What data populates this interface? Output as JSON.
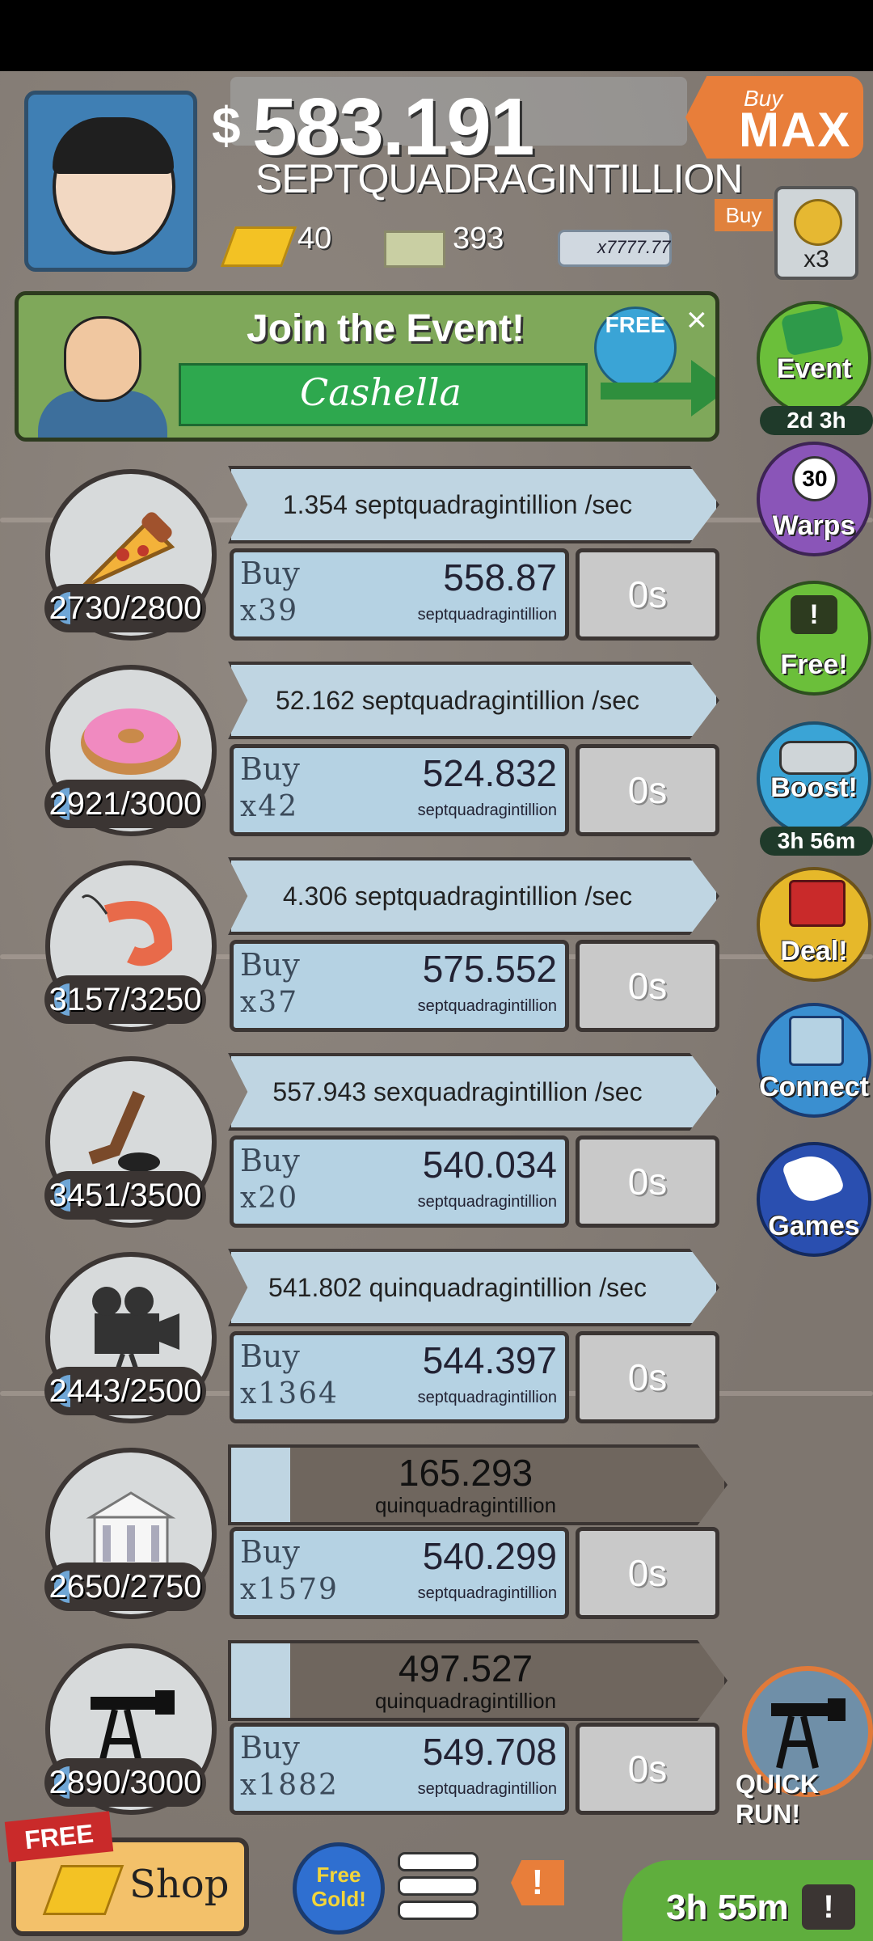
{
  "header": {
    "currency_symbol": "$",
    "money_value": "583.191",
    "money_unit": "SEPTQUADRAGINTILLION",
    "buy_max": {
      "top": "Buy",
      "bottom": "MAX"
    },
    "gold": "40",
    "megabucks": "393",
    "megaticket": "x7777.77",
    "buy_multiplier_tag": "Buy",
    "bag_multiplier": "x3"
  },
  "event_banner": {
    "title": "Join the Event!",
    "name": "Cashella",
    "free": "FREE",
    "close": "×"
  },
  "businesses": [
    {
      "name": "pizza",
      "count": "2730/2800",
      "fill": 0.975,
      "rate": "1.354 septquadragintillion /sec",
      "buy_label": "Buy",
      "buy_qty": "x39",
      "cost": "558.87",
      "cost_unit": "septquadragintillion",
      "timer": "0s"
    },
    {
      "name": "donut",
      "count": "2921/3000",
      "fill": 0.974,
      "rate": "52.162 septquadragintillion /sec",
      "buy_label": "Buy",
      "buy_qty": "x42",
      "cost": "524.832",
      "cost_unit": "septquadragintillion",
      "timer": "0s"
    },
    {
      "name": "shrimp",
      "count": "3157/3250",
      "fill": 0.971,
      "rate": "4.306 septquadragintillion /sec",
      "buy_label": "Buy",
      "buy_qty": "x37",
      "cost": "575.552",
      "cost_unit": "septquadragintillion",
      "timer": "0s"
    },
    {
      "name": "hockey",
      "count": "3451/3500",
      "fill": 0.986,
      "rate": "557.943 sexquadragintillion /sec",
      "buy_label": "Buy",
      "buy_qty": "x20",
      "cost": "540.034",
      "cost_unit": "septquadragintillion",
      "timer": "0s"
    },
    {
      "name": "movie",
      "count": "2443/2500",
      "fill": 0.977,
      "rate": "541.802 quinquadragintillion /sec",
      "buy_label": "Buy",
      "buy_qty": "x1364",
      "cost": "544.397",
      "cost_unit": "septquadragintillion",
      "timer": "0s"
    },
    {
      "name": "bank",
      "count": "2650/2750",
      "fill": 0.964,
      "progress_value": "165.293",
      "progress_unit": "quinquadragintillion",
      "progress": 0.12,
      "buy_label": "Buy",
      "buy_qty": "x1579",
      "cost": "540.299",
      "cost_unit": "septquadragintillion",
      "timer": "0s"
    },
    {
      "name": "oil",
      "count": "2890/3000",
      "fill": 0.963,
      "progress_value": "497.527",
      "progress_unit": "quinquadragintillion",
      "progress": 0.12,
      "buy_label": "Buy",
      "buy_qty": "x1882",
      "cost": "549.708",
      "cost_unit": "septquadragintillion",
      "timer": "0s"
    }
  ],
  "sidebar": {
    "event": {
      "label": "Event",
      "sub": "2d 3h",
      "color": "#6bbf3a"
    },
    "warps": {
      "label": "Warps",
      "count": "30",
      "color": "#8a55b8"
    },
    "free": {
      "label": "Free!",
      "color": "#6bbf3a"
    },
    "boost": {
      "label": "Boost!",
      "sub": "3h 56m",
      "color": "#3aa4d6"
    },
    "deal": {
      "label": "Deal!",
      "color": "#e6b82a"
    },
    "connect": {
      "label": "Connect",
      "color": "#3a8fd0"
    },
    "games": {
      "label": "Games",
      "color": "#2a4fb0"
    }
  },
  "quick_run": "QUICK RUN!",
  "bottom": {
    "free_tag": "FREE",
    "shop": "Shop",
    "free_gold": "Free Gold!",
    "timer": "3h 55m",
    "alert": "!"
  }
}
